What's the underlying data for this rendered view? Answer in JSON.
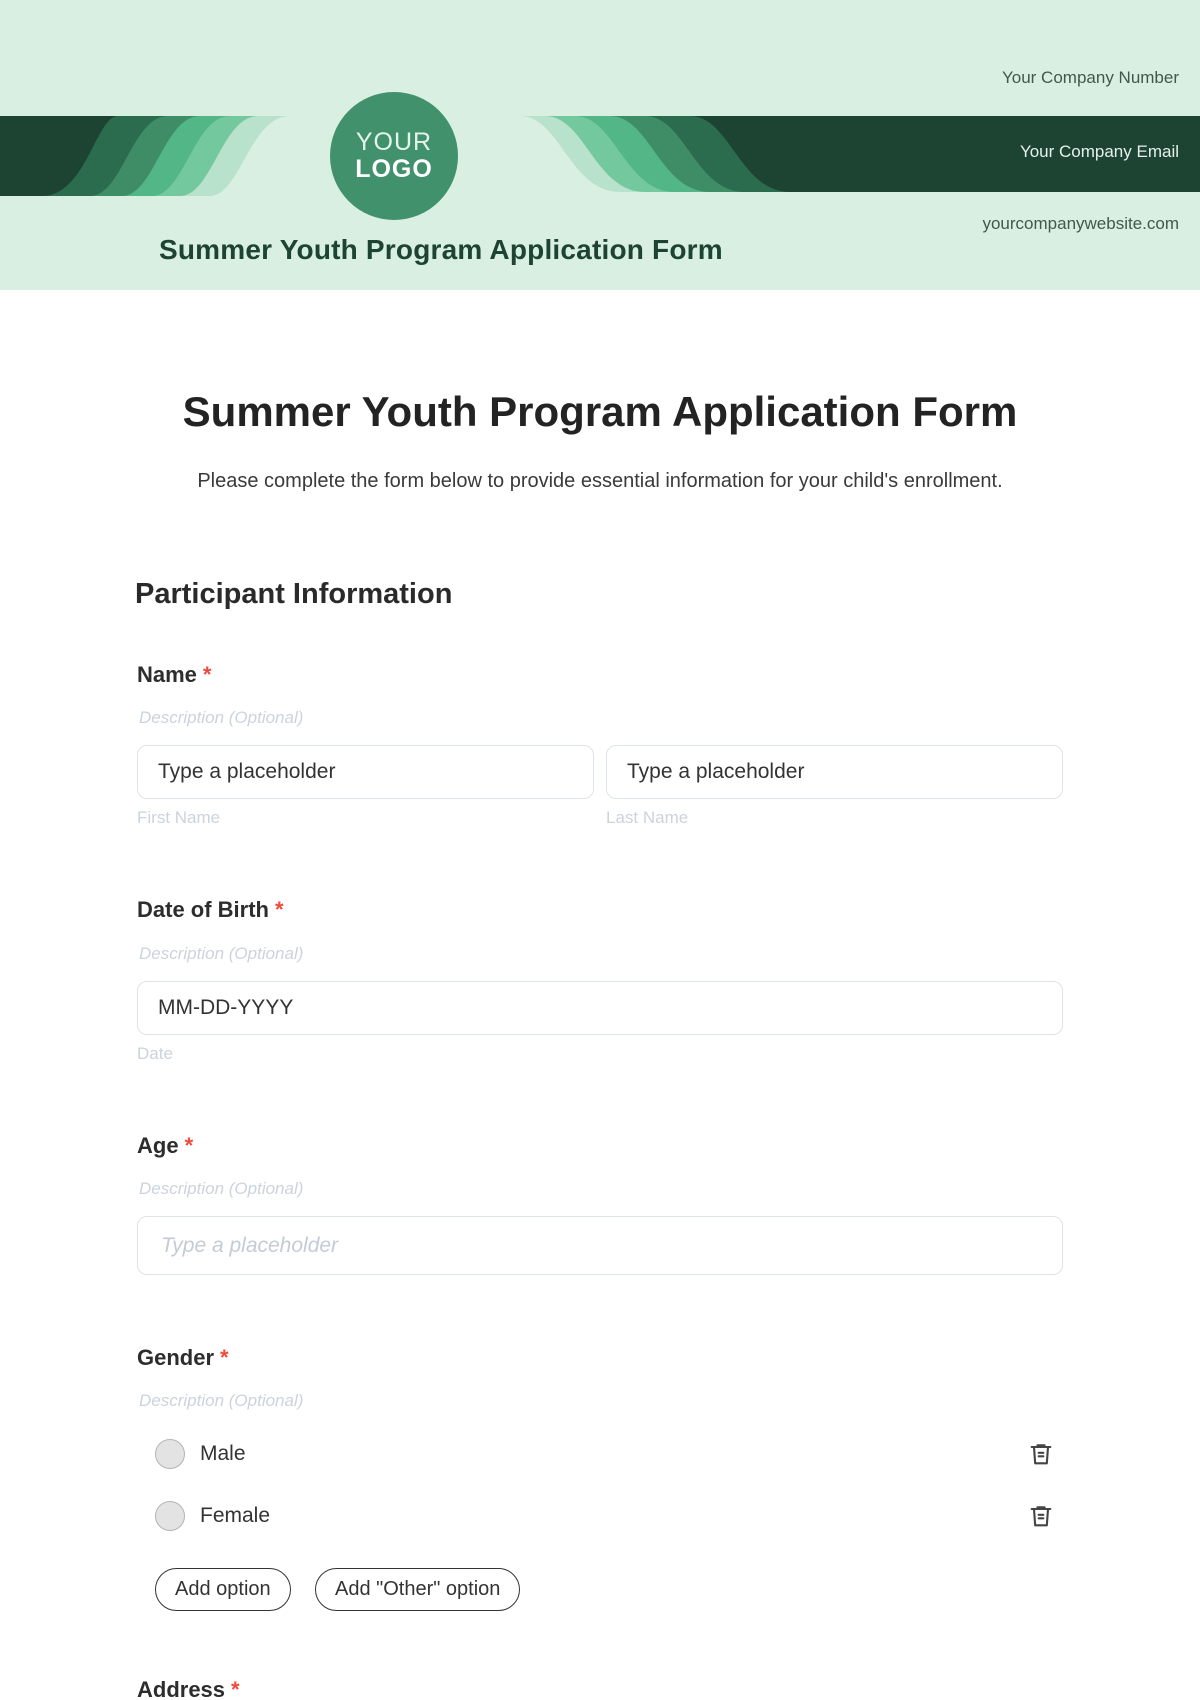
{
  "header": {
    "logo": {
      "line1": "YOUR",
      "line2": "LOGO"
    },
    "title": "Summer Youth Program Application Form",
    "contact": {
      "number": "Your Company Number",
      "email": "Your Company Email",
      "website": "yourcompanywebsite.com"
    },
    "colors": {
      "background": "#d9efe2",
      "band_dark": "#1d4433",
      "logo_fill": "#41916d"
    }
  },
  "form": {
    "title": "Summer Youth Program Application Form",
    "subtitle": "Please complete the form below to provide essential information for your child's enrollment.",
    "section": "Participant Information",
    "required_marker": "*",
    "fields": {
      "name": {
        "label": "Name",
        "description": "Description (Optional)",
        "first": {
          "value": "Type a placeholder",
          "sublabel": "First Name"
        },
        "last": {
          "value": "Type a placeholder",
          "sublabel": "Last Name"
        }
      },
      "dob": {
        "label": "Date of Birth",
        "description": "Description (Optional)",
        "value": "MM-DD-YYYY",
        "sublabel": "Date"
      },
      "age": {
        "label": "Age",
        "description": "Description (Optional)",
        "placeholder": "Type a placeholder"
      },
      "gender": {
        "label": "Gender",
        "description": "Description (Optional)",
        "options": [
          {
            "label": "Male",
            "icon": "trash-icon"
          },
          {
            "label": "Female",
            "icon": "trash-icon"
          }
        ],
        "add_option": "Add option",
        "add_other_option": "Add \"Other\" option"
      },
      "address": {
        "label": "Address"
      }
    }
  }
}
